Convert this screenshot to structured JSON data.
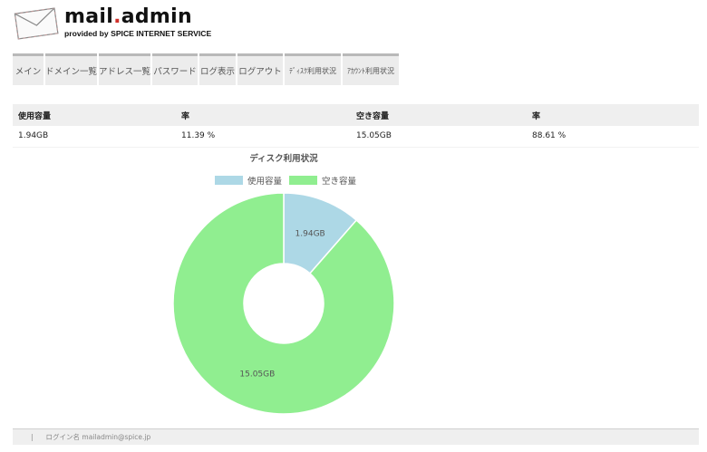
{
  "header": {
    "logo_main": "mail",
    "logo_dot": ".",
    "logo_suffix": "admin",
    "logo_sub": "provided by SPICE INTERNET SERVICE"
  },
  "nav": {
    "items": [
      {
        "label": "メイン"
      },
      {
        "label": "ドメイン一覧"
      },
      {
        "label": "アドレス一覧"
      },
      {
        "label": "パスワード"
      },
      {
        "label": "ログ表示"
      },
      {
        "label": "ログアウト"
      },
      {
        "label": "ﾃﾞｨｽｸ利用状況"
      },
      {
        "label": "ｱｶｳﾝﾄ利用状況"
      }
    ]
  },
  "table": {
    "headers": [
      "使用容量",
      "率",
      "空き容量",
      "率"
    ],
    "row": [
      "1.94GB",
      "11.39 %",
      "15.05GB",
      "88.61 %"
    ]
  },
  "chart_data": {
    "type": "pie",
    "title": "ディスク利用状況",
    "categories": [
      "使用容量",
      "空き容量"
    ],
    "values": [
      1.94,
      15.05
    ],
    "data_labels": [
      "1.94GB",
      "15.05GB"
    ],
    "colors": [
      "#add8e6",
      "#90ee90"
    ],
    "legend_position": "top"
  },
  "footer": {
    "separator": "|",
    "login_text": "ログイン名 mailadmin@spice.jp"
  }
}
